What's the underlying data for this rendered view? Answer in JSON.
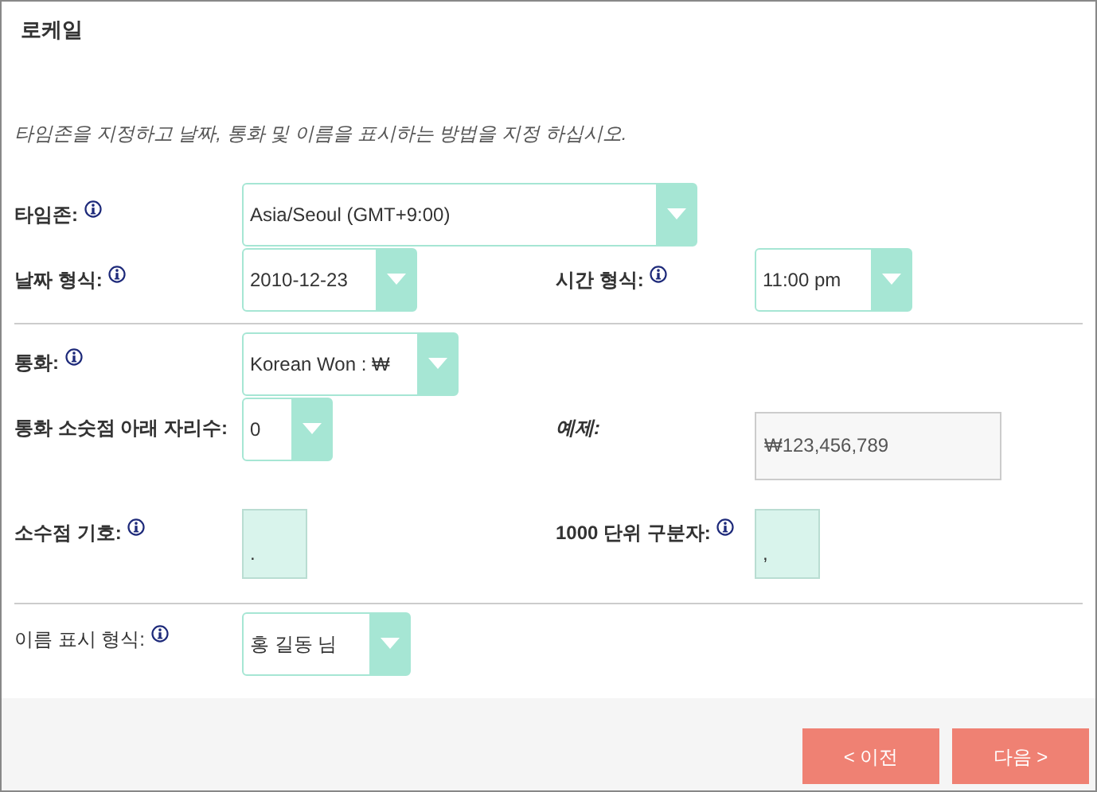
{
  "title": "로케일",
  "description": "타임존을 지정하고 날짜, 통화 및 이름을 표시하는 방법을 지정 하십시오.",
  "timezone": {
    "label": "타임존:",
    "bold": true,
    "value": "Asia/Seoul (GMT+9:00)"
  },
  "date_format": {
    "label": "날짜 형식:",
    "bold": true,
    "value": "2010-12-23"
  },
  "time_format": {
    "label": "시간 형식:",
    "bold": true,
    "value": "11:00 pm"
  },
  "currency": {
    "label": "통화:",
    "bold": true,
    "value": "Korean Won : ₩"
  },
  "decimal_places": {
    "label": "통화 소숫점 아래 자리수:",
    "bold": true,
    "value": "0"
  },
  "example": {
    "label": "예제:",
    "value": "₩123,456,789"
  },
  "decimal_symbol": {
    "label": "소수점 기호:",
    "bold": true,
    "value": "."
  },
  "thousands_separator": {
    "label": "1000 단위 구분자:",
    "bold": true,
    "value": ","
  },
  "name_format": {
    "label": "이름 표시 형식:",
    "bold": false,
    "value": "홍 길동 님"
  },
  "buttons": [
    {
      "label": "< 이전"
    },
    {
      "label": "다음 >"
    }
  ]
}
